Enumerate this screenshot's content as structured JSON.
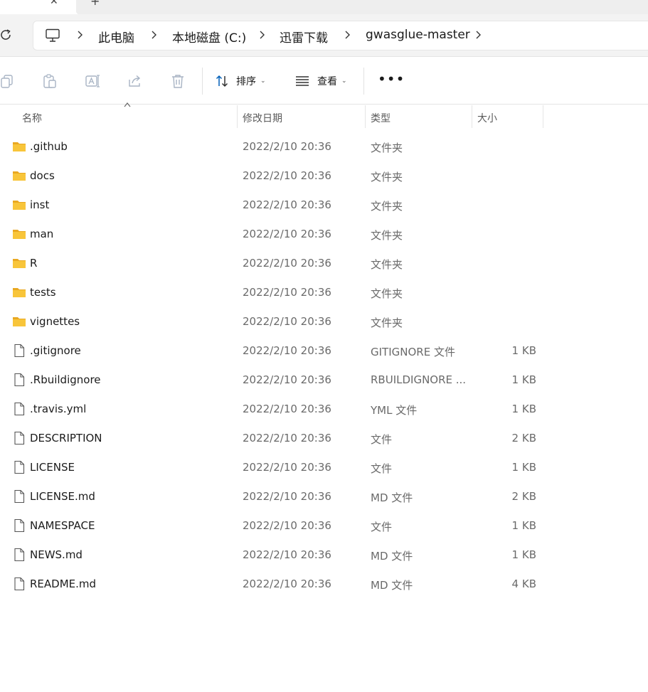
{
  "tabs": {
    "close_glyph": "✕",
    "new_tab_glyph": "+"
  },
  "breadcrumb": [
    {
      "label": "此电脑"
    },
    {
      "label": "本地磁盘 (C:)"
    },
    {
      "label": "迅雷下载"
    },
    {
      "label": "gwasglue-master"
    }
  ],
  "toolbar": {
    "icons": [
      "copy-icon",
      "paste-icon",
      "rename-icon",
      "share-icon",
      "delete-icon"
    ],
    "sort_label": "排序",
    "view_label": "查看",
    "more_label": "•••"
  },
  "columns": {
    "name": "名称",
    "modified": "修改日期",
    "type": "类型",
    "size": "大小"
  },
  "files": [
    {
      "name": ".github",
      "modified": "2022/2/10 20:36",
      "type": "文件夹",
      "size": "",
      "icon": "folder-icon"
    },
    {
      "name": "docs",
      "modified": "2022/2/10 20:36",
      "type": "文件夹",
      "size": "",
      "icon": "folder-icon"
    },
    {
      "name": "inst",
      "modified": "2022/2/10 20:36",
      "type": "文件夹",
      "size": "",
      "icon": "folder-icon"
    },
    {
      "name": "man",
      "modified": "2022/2/10 20:36",
      "type": "文件夹",
      "size": "",
      "icon": "folder-icon"
    },
    {
      "name": "R",
      "modified": "2022/2/10 20:36",
      "type": "文件夹",
      "size": "",
      "icon": "folder-icon"
    },
    {
      "name": "tests",
      "modified": "2022/2/10 20:36",
      "type": "文件夹",
      "size": "",
      "icon": "folder-icon"
    },
    {
      "name": "vignettes",
      "modified": "2022/2/10 20:36",
      "type": "文件夹",
      "size": "",
      "icon": "folder-icon"
    },
    {
      "name": ".gitignore",
      "modified": "2022/2/10 20:36",
      "type": "GITIGNORE 文件",
      "size": "1 KB",
      "icon": "file-icon"
    },
    {
      "name": ".Rbuildignore",
      "modified": "2022/2/10 20:36",
      "type": "RBUILDIGNORE ...",
      "size": "1 KB",
      "icon": "file-icon"
    },
    {
      "name": ".travis.yml",
      "modified": "2022/2/10 20:36",
      "type": "YML 文件",
      "size": "1 KB",
      "icon": "file-icon"
    },
    {
      "name": "DESCRIPTION",
      "modified": "2022/2/10 20:36",
      "type": "文件",
      "size": "2 KB",
      "icon": "file-icon"
    },
    {
      "name": "LICENSE",
      "modified": "2022/2/10 20:36",
      "type": "文件",
      "size": "1 KB",
      "icon": "file-icon"
    },
    {
      "name": "LICENSE.md",
      "modified": "2022/2/10 20:36",
      "type": "MD 文件",
      "size": "2 KB",
      "icon": "file-icon"
    },
    {
      "name": "NAMESPACE",
      "modified": "2022/2/10 20:36",
      "type": "文件",
      "size": "1 KB",
      "icon": "file-icon"
    },
    {
      "name": "NEWS.md",
      "modified": "2022/2/10 20:36",
      "type": "MD 文件",
      "size": "1 KB",
      "icon": "file-icon"
    },
    {
      "name": "README.md",
      "modified": "2022/2/10 20:36",
      "type": "MD 文件",
      "size": "4 KB",
      "icon": "file-icon"
    }
  ],
  "colors": {
    "folder": "#f8c53a",
    "folder_dark": "#e9a821",
    "accent": "#005fb8"
  }
}
